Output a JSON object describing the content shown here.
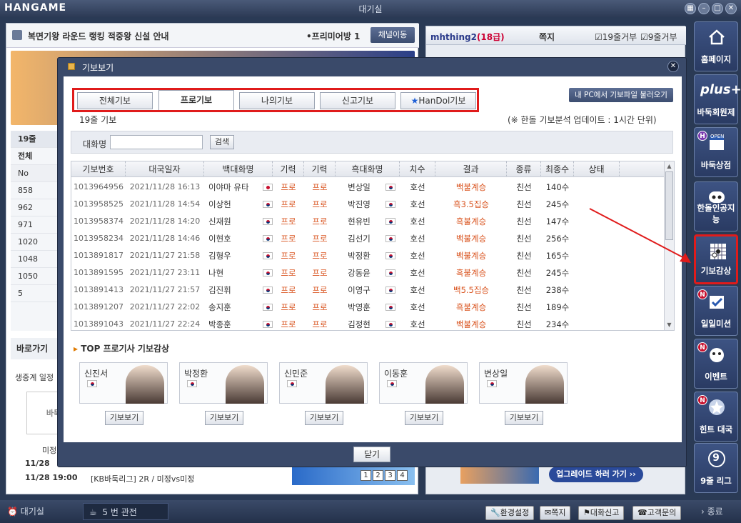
{
  "window": {
    "logo": "HANGAME",
    "title": "대기실"
  },
  "notice": {
    "text": "복면기왕 라운드 랭킹 적중왕 신설 안내",
    "premium": "•프리미어방 1",
    "channel_btn": "채널이동"
  },
  "left": {
    "list_header": "19줄",
    "list_tab_all": "전체",
    "list_col_no": "No",
    "list_items": [
      "858",
      "962",
      "971",
      "1020",
      "1048",
      "1050",
      "5"
    ],
    "goto": "바로가기",
    "schedule": "생중계 일정",
    "baduk_logo": "바둑",
    "mijeong": "미정",
    "sched_rows": [
      {
        "date": "11/28",
        "text": ""
      },
      {
        "date": "11/28 19:00",
        "text": "[KB바둑리그] 2R / 미정vs미정"
      }
    ],
    "pages": [
      "1",
      "2",
      "3",
      "4"
    ]
  },
  "right": {
    "user": "mhthing2",
    "grade": "(18급)",
    "msg": "쪽지",
    "refuse19": "19줄거부",
    "refuse9": "9줄거부",
    "upgrade": "업그레이드 하러 가기 ››"
  },
  "modal": {
    "title": "기보보기",
    "tabs": [
      "전체기보",
      "프로기보",
      "나의기보",
      "신고기보",
      "HanDol기보"
    ],
    "load_btn": "내 PC에서 기보파일 불러오기",
    "label": "19줄 기보",
    "note": "(※ 한돌 기보분석 업데이트 : 1시간 단위)",
    "search_label": "대화명",
    "search_placeholder": "",
    "search_btn": "검색",
    "columns": [
      "기보번호",
      "대국일자",
      "백대화명",
      "기력",
      "기력",
      "흑대화명",
      "치수",
      "결과",
      "종류",
      "최종수",
      "상태"
    ],
    "rows": [
      {
        "id": "1013964956",
        "date": "2021/11/28 16:13",
        "white": "이야마 유타",
        "wflag": "jp",
        "wlvl": "프로",
        "blvl": "프로",
        "black": "변상일",
        "bflag": "kr",
        "handicap": "호선",
        "result": "백불계승",
        "kind": "친선",
        "moves": "140수"
      },
      {
        "id": "1013958525",
        "date": "2021/11/28 14:54",
        "white": "이상헌",
        "wflag": "kr",
        "wlvl": "프로",
        "blvl": "프로",
        "black": "박진영",
        "bflag": "kr",
        "handicap": "호선",
        "result": "흑3.5집승",
        "kind": "친선",
        "moves": "245수"
      },
      {
        "id": "1013958374",
        "date": "2021/11/28 14:20",
        "white": "신재원",
        "wflag": "kr",
        "wlvl": "프로",
        "blvl": "프로",
        "black": "현유빈",
        "bflag": "kr",
        "handicap": "호선",
        "result": "흑불계승",
        "kind": "친선",
        "moves": "147수"
      },
      {
        "id": "1013958234",
        "date": "2021/11/28 14:46",
        "white": "이현호",
        "wflag": "kr",
        "wlvl": "프로",
        "blvl": "프로",
        "black": "김선기",
        "bflag": "kr",
        "handicap": "호선",
        "result": "백불계승",
        "kind": "친선",
        "moves": "256수"
      },
      {
        "id": "1013891817",
        "date": "2021/11/27 21:58",
        "white": "김형우",
        "wflag": "kr",
        "wlvl": "프로",
        "blvl": "프로",
        "black": "박정환",
        "bflag": "kr",
        "handicap": "호선",
        "result": "백불계승",
        "kind": "친선",
        "moves": "165수"
      },
      {
        "id": "1013891595",
        "date": "2021/11/27 23:11",
        "white": "나현",
        "wflag": "kr",
        "wlvl": "프로",
        "blvl": "프로",
        "black": "강동윤",
        "bflag": "kr",
        "handicap": "호선",
        "result": "흑불계승",
        "kind": "친선",
        "moves": "245수"
      },
      {
        "id": "1013891413",
        "date": "2021/11/27 21:57",
        "white": "김진휘",
        "wflag": "kr",
        "wlvl": "프로",
        "blvl": "프로",
        "black": "이영구",
        "bflag": "kr",
        "handicap": "호선",
        "result": "백5.5집승",
        "kind": "친선",
        "moves": "238수"
      },
      {
        "id": "1013891207",
        "date": "2021/11/27 22:02",
        "white": "송지훈",
        "wflag": "kr",
        "wlvl": "프로",
        "blvl": "프로",
        "black": "박영훈",
        "bflag": "kr",
        "handicap": "호선",
        "result": "흑불계승",
        "kind": "친선",
        "moves": "189수"
      },
      {
        "id": "1013891043",
        "date": "2021/11/27 22:24",
        "white": "박종훈",
        "wflag": "kr",
        "wlvl": "프로",
        "blvl": "프로",
        "black": "김정현",
        "bflag": "kr",
        "handicap": "호선",
        "result": "백불계승",
        "kind": "친선",
        "moves": "234수"
      }
    ],
    "top_title": "TOP 프로기사 기보감상",
    "pros": [
      "신진서",
      "박정환",
      "신민준",
      "이동훈",
      "변상일"
    ],
    "pro_btn": "기보보기",
    "close": "닫기"
  },
  "sidebar": [
    "홈페이지",
    "바둑회원제",
    "바둑상점",
    "한돌인공지능",
    "기보감상",
    "일일미션",
    "이벤트",
    "힌트 대국",
    "9줄 리그"
  ],
  "sidebar_misc": {
    "plus": "plus+",
    "open": "OPEN",
    "nine": "9"
  },
  "taskbar": {
    "lobby": "대기실",
    "watch": "5 번 관전",
    "settings": "환경설정",
    "msg": "쪽지",
    "report": "대화신고",
    "support": "고객문의",
    "quit": "종료"
  },
  "colors": {
    "accent_red": "#e01b1b",
    "result_orange": "#d9531e",
    "navy": "#3a4a6a"
  }
}
